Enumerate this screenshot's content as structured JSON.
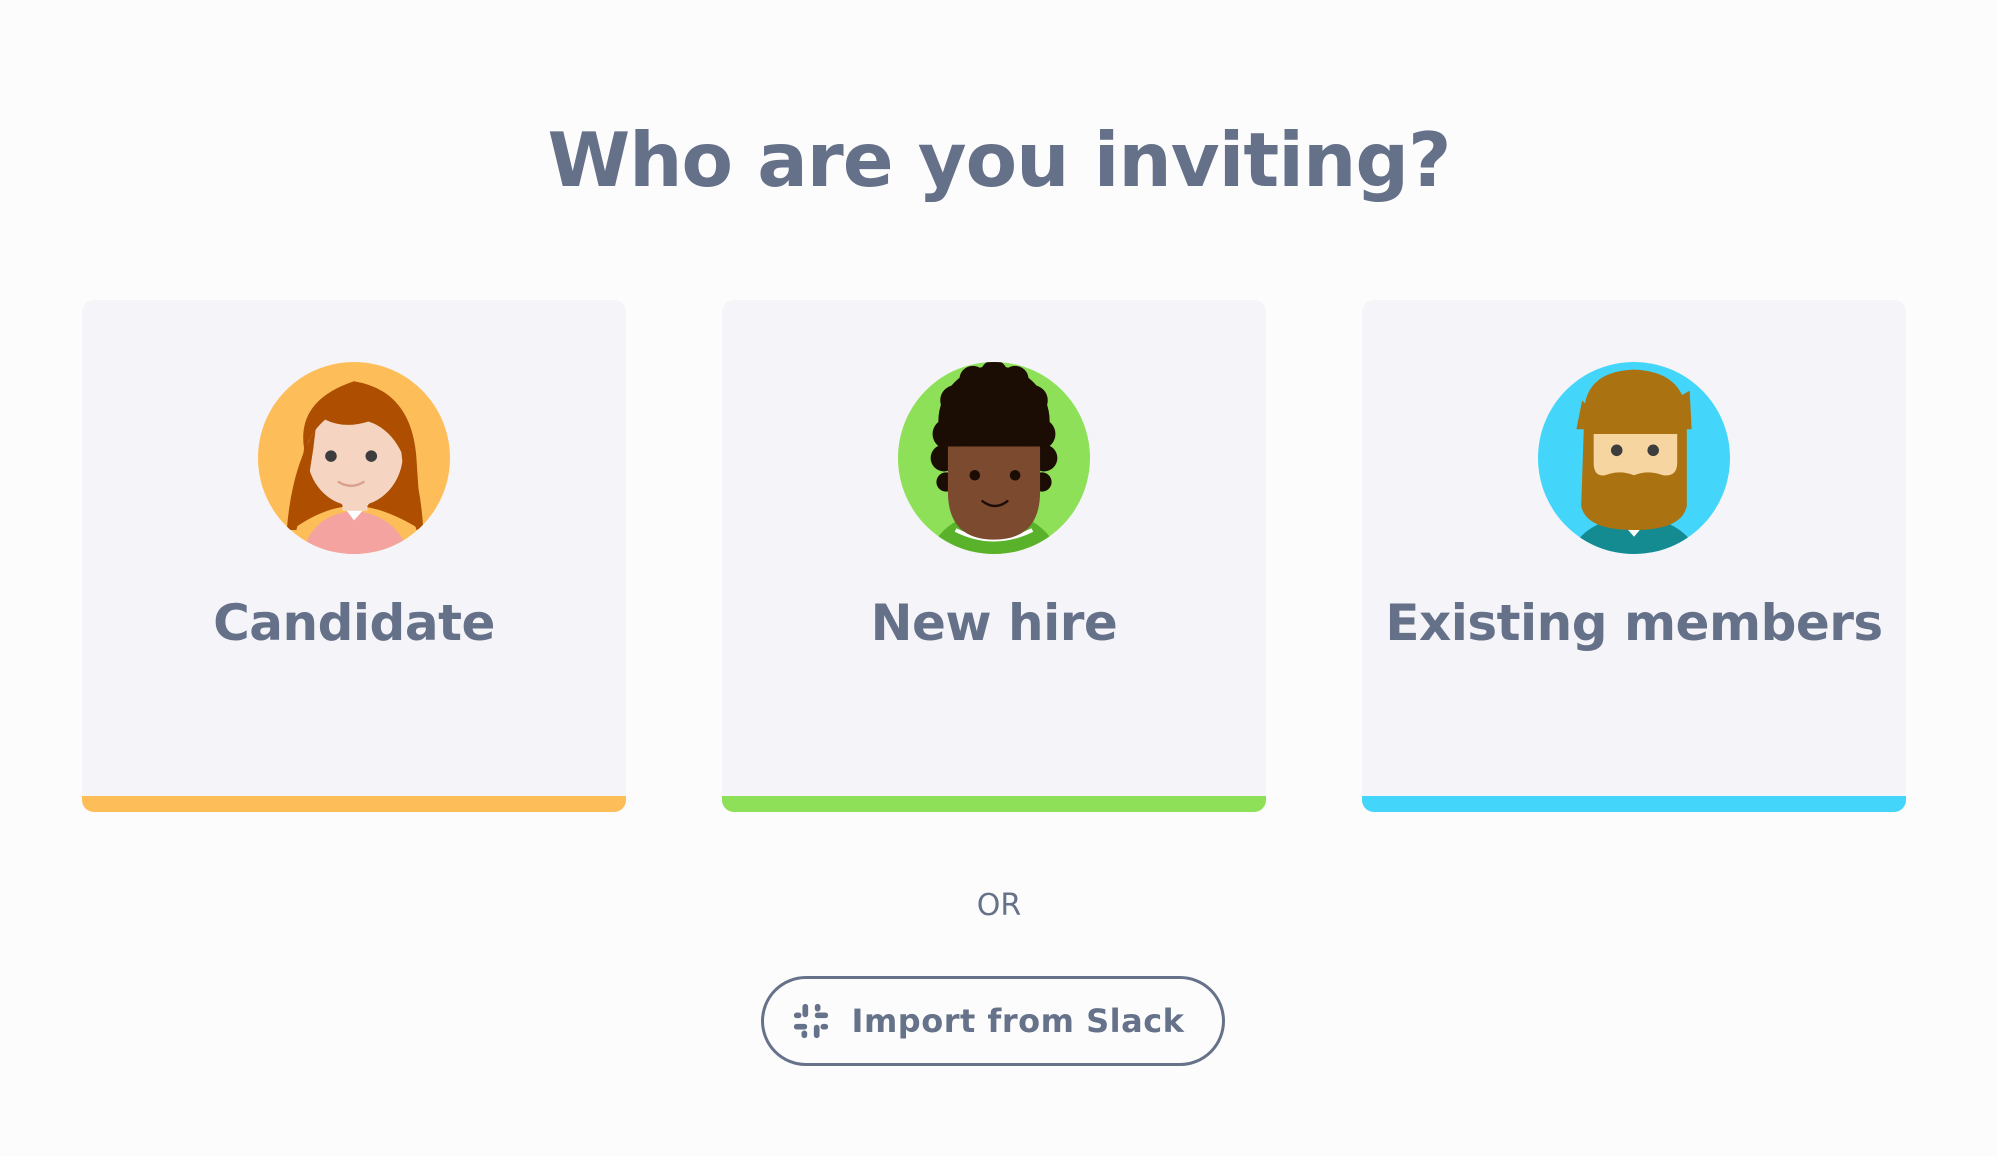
{
  "page": {
    "title": "Who are you inviting?"
  },
  "options": [
    {
      "label": "Candidate",
      "accent": "#fdbe5a",
      "icon": "candidate-avatar-icon"
    },
    {
      "label": "New hire",
      "accent": "#8fe059",
      "icon": "new-hire-avatar-icon"
    },
    {
      "label": "Existing members",
      "accent": "#44d6fa",
      "icon": "existing-members-avatar-icon"
    }
  ],
  "divider": {
    "text": "OR"
  },
  "slack": {
    "button_label": "Import from Slack",
    "icon": "slack-icon"
  },
  "colors": {
    "background": "#fcfcfd",
    "card": "#f5f5f9",
    "text": "#657089"
  }
}
